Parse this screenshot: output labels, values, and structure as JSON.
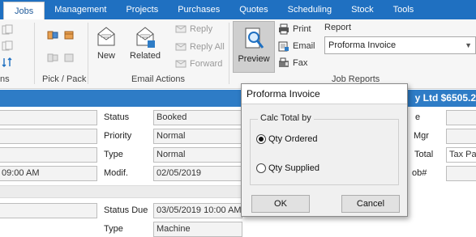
{
  "menubar": {
    "tabs": [
      {
        "label": "Jobs",
        "active": true
      },
      {
        "label": "Management"
      },
      {
        "label": "Projects"
      },
      {
        "label": "Purchases"
      },
      {
        "label": "Quotes"
      },
      {
        "label": "Scheduling"
      },
      {
        "label": "Stock"
      },
      {
        "label": "Tools"
      }
    ]
  },
  "ribbon": {
    "groups": {
      "partial_left": "ns",
      "pick_pack": "Pick / Pack",
      "email_actions": "Email Actions",
      "job_reports": "Job Reports"
    },
    "buttons": {
      "new": "New",
      "related": "Related",
      "reply": "Reply",
      "reply_all": "Reply All",
      "forward": "Forward",
      "preview": "Preview",
      "print": "Print",
      "email": "Email",
      "fax": "Fax"
    },
    "report": {
      "label": "Report",
      "selected": "Proforma Invoice"
    }
  },
  "bluebar": {
    "right_text": "y Ltd $6505.2"
  },
  "form": {
    "status_label": "Status",
    "status_value": "Booked",
    "priority_label": "Priority",
    "priority_value": "Normal",
    "type_label": "Type",
    "type_value": "Normal",
    "modif_label": "Modif.",
    "modif_value": "02/05/2019",
    "time_value": "09:00 AM",
    "status_due_label": "Status Due",
    "status_due_value": "03/05/2019 10:00 AM",
    "type2_label": "Type",
    "type2_value": "Machine",
    "right_labels": {
      "e": "e",
      "mgr": "Mgr",
      "total": "Total",
      "tax_value": "Tax Pa",
      "job": "ob#"
    }
  },
  "dialog": {
    "title": "Proforma Invoice",
    "group_label": "Calc Total by",
    "options": [
      {
        "label": "Qty Ordered",
        "checked": true
      },
      {
        "label": "Qty Supplied",
        "checked": false
      }
    ],
    "ok": "OK",
    "cancel": "Cancel"
  }
}
